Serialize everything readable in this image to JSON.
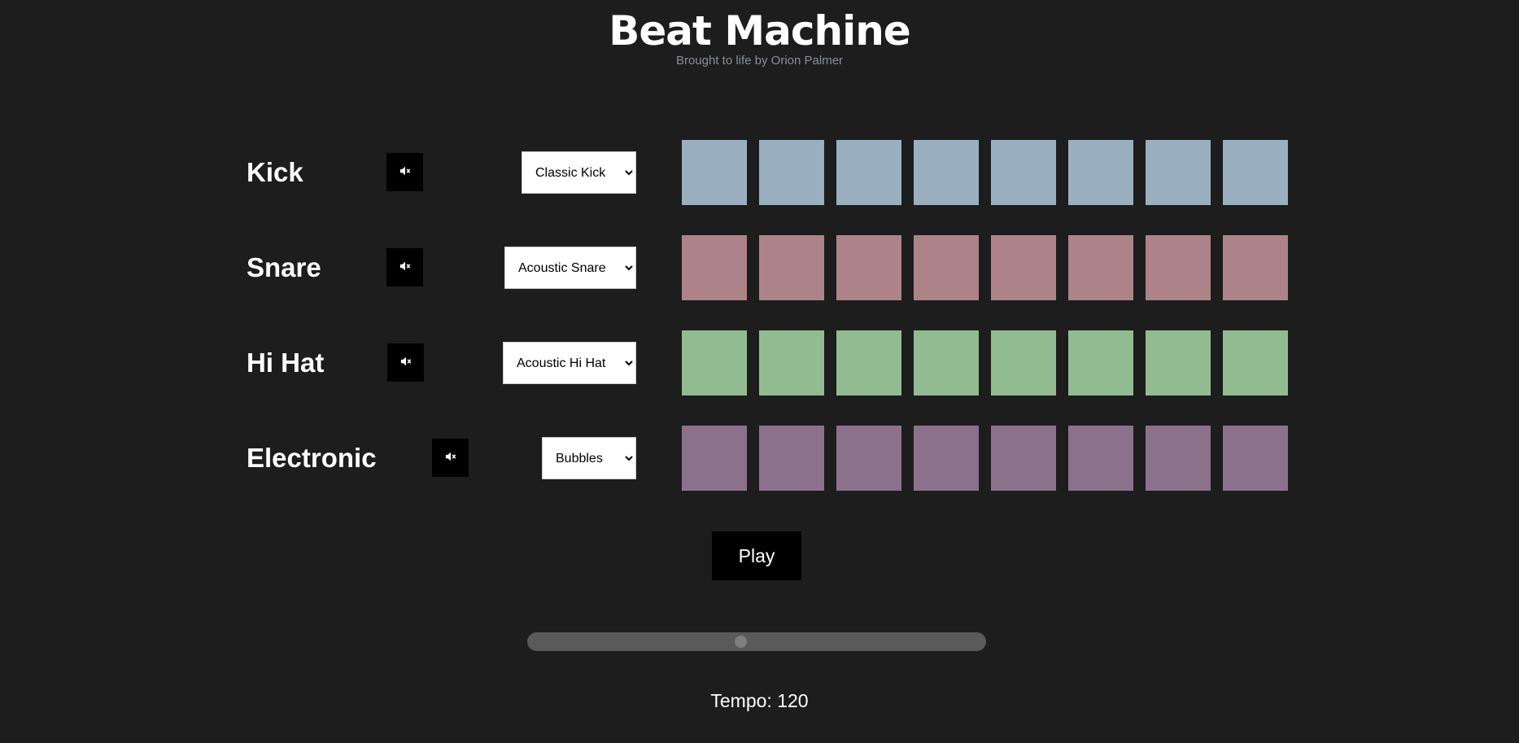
{
  "header": {
    "title": "Beat Machine",
    "subtitle": "Brought to life by Orion Palmer"
  },
  "tracks": [
    {
      "name": "Kick",
      "sound": "Classic Kick",
      "pad_color": "#9aafbf",
      "pads": 8
    },
    {
      "name": "Snare",
      "sound": "Acoustic Snare",
      "pad_color": "#ad8389",
      "pads": 8
    },
    {
      "name": "Hi Hat",
      "sound": "Acoustic Hi Hat",
      "pad_color": "#92bb92",
      "pads": 8
    },
    {
      "name": "Electronic",
      "sound": "Bubbles",
      "pad_color": "#8c718c",
      "pads": 8
    }
  ],
  "icons": {
    "mute": "mute-icon"
  },
  "controls": {
    "play_label": "Play",
    "tempo_label": "Tempo: 120",
    "tempo_value": 120,
    "tempo_fraction": 0.465
  },
  "colors": {
    "background": "#1d1d1d",
    "button": "#000000",
    "slider_track": "#5a5a5a",
    "slider_thumb": "#7f7f7f"
  }
}
